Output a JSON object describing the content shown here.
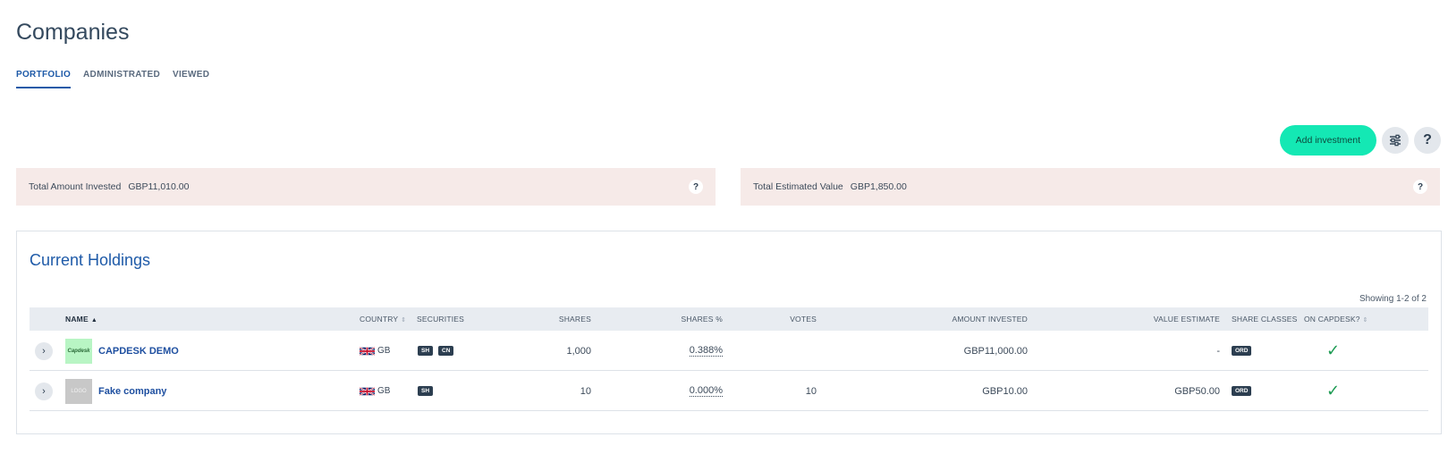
{
  "page": {
    "title": "Companies"
  },
  "tabs": [
    {
      "label": "PORTFOLIO",
      "active": true
    },
    {
      "label": "ADMINISTRATED",
      "active": false
    },
    {
      "label": "VIEWED",
      "active": false
    }
  ],
  "toolbar": {
    "add_label": "Add investment",
    "filter_icon": "sliders-icon",
    "help_label": "?"
  },
  "summary": {
    "invested_label": "Total Amount Invested",
    "invested_value": "GBP11,010.00",
    "estimated_label": "Total Estimated Value",
    "estimated_value": "GBP1,850.00",
    "help": "?"
  },
  "holdings": {
    "title": "Current Holdings",
    "showing": "Showing 1-2 of 2",
    "columns": {
      "name": "NAME",
      "country": "COUNTRY",
      "securities": "SECURITIES",
      "shares": "SHARES",
      "shares_pct": "SHARES %",
      "votes": "VOTES",
      "amount_invested": "AMOUNT INVESTED",
      "value_estimate": "VALUE ESTIMATE",
      "share_classes": "SHARE CLASSES",
      "on_capdesk": "ON CAPDESK?"
    },
    "rows": [
      {
        "logo_text": "Capdesk",
        "name": "CAPDESK DEMO",
        "country": "GB",
        "securities": [
          "SH",
          "CN"
        ],
        "shares": "1,000",
        "shares_pct": "0.388%",
        "votes": "",
        "amount_invested": "GBP11,000.00",
        "value_estimate": "-",
        "share_class": "ORD",
        "on_capdesk": "✓"
      },
      {
        "logo_text": "LOGO",
        "name": "Fake company",
        "country": "GB",
        "securities": [
          "SH"
        ],
        "shares": "10",
        "shares_pct": "0.000%",
        "votes": "10",
        "amount_invested": "GBP10.00",
        "value_estimate": "GBP50.00",
        "share_class": "ORD",
        "on_capdesk": "✓"
      }
    ]
  },
  "colors": {
    "accent": "#1e5aa8",
    "cta": "#14e8b4",
    "summary_bg": "#f6eae8",
    "check": "#1c9a52"
  }
}
